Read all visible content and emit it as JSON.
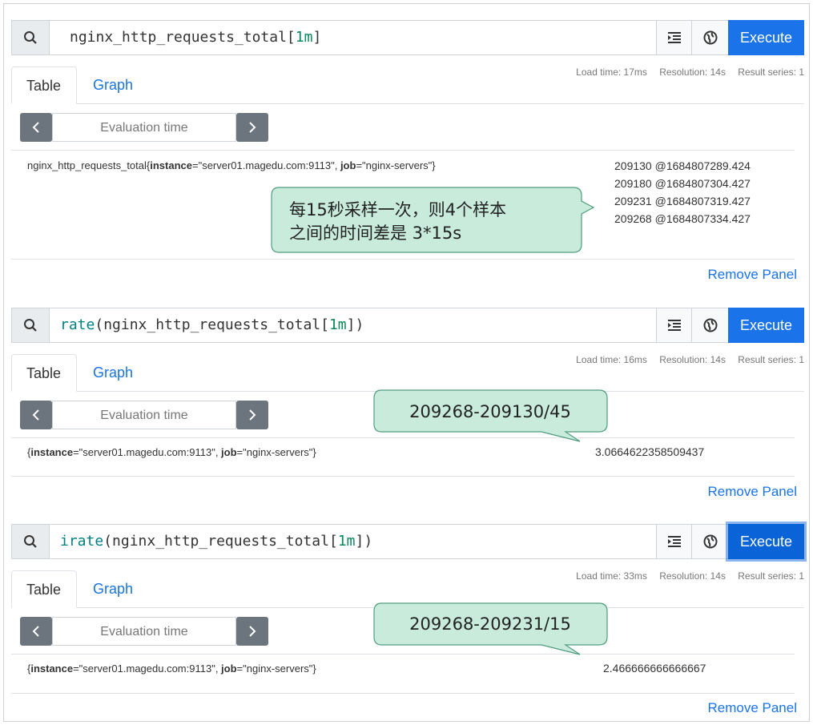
{
  "panels": [
    {
      "expr_parts": [
        {
          "t": "nginx_http_requests_total[",
          "c": "plain"
        },
        {
          "t": "1m",
          "c": "num"
        },
        {
          "t": "]",
          "c": "plain"
        }
      ],
      "execute_label": "Execute",
      "tab_table": "Table",
      "tab_graph": "Graph",
      "load_time": "Load time: 17ms",
      "resolution": "Resolution: 14s",
      "result_series": "Result series: 1",
      "eval_placeholder": "Evaluation time",
      "metric_name": "nginx_http_requests_total{",
      "instance_key": "instance",
      "instance_val": "=\"server01.magedu.com:9113\", ",
      "job_key": "job",
      "job_val": "=\"nginx-servers\"}",
      "values": [
        "209130 @1684807289.424",
        "209180 @1684807304.427",
        "209231 @1684807319.427",
        "209268 @1684807334.427"
      ],
      "remove_label": "Remove Panel",
      "callout": [
        "每15秒采样一次，则4个样本",
        "之间的时间差是 3*15s"
      ]
    },
    {
      "expr_parts": [
        {
          "t": "rate",
          "c": "fn"
        },
        {
          "t": "(nginx_http_requests_total[",
          "c": "plain"
        },
        {
          "t": "1m",
          "c": "num"
        },
        {
          "t": "])",
          "c": "plain"
        }
      ],
      "execute_label": "Execute",
      "tab_table": "Table",
      "tab_graph": "Graph",
      "load_time": "Load time: 16ms",
      "resolution": "Resolution: 14s",
      "result_series": "Result series: 1",
      "eval_placeholder": "Evaluation time",
      "metric_name": "{",
      "instance_key": "instance",
      "instance_val": "=\"server01.magedu.com:9113\", ",
      "job_key": "job",
      "job_val": "=\"nginx-servers\"}",
      "value": "3.0664622358509437",
      "remove_label": "Remove Panel",
      "callout": [
        "209268-209130/45"
      ]
    },
    {
      "expr_parts": [
        {
          "t": "irate",
          "c": "fn"
        },
        {
          "t": "(nginx_http_requests_total[",
          "c": "plain"
        },
        {
          "t": "1m",
          "c": "num"
        },
        {
          "t": "])",
          "c": "plain"
        }
      ],
      "execute_label": "Execute",
      "tab_table": "Table",
      "tab_graph": "Graph",
      "load_time": "Load time: 33ms",
      "resolution": "Resolution: 14s",
      "result_series": "Result series: 1",
      "eval_placeholder": "Evaluation time",
      "metric_name": "{",
      "instance_key": "instance",
      "instance_val": "=\"server01.magedu.com:9113\", ",
      "job_key": "job",
      "job_val": "=\"nginx-servers\"}",
      "value": "2.466666666666667",
      "remove_label": "Remove Panel",
      "callout": [
        "209268-209231/15"
      ]
    }
  ],
  "icons": {
    "search": "search-icon",
    "format": "format-expression-icon",
    "globe": "metrics-explorer-icon",
    "prev": "chevron-left-icon",
    "next": "chevron-right-icon"
  },
  "colors": {
    "accent": "#1a73e8",
    "callout_fill": "#c8ebdc",
    "callout_border": "#4f9c7e",
    "fn": "#008080",
    "number": "#09885a"
  }
}
